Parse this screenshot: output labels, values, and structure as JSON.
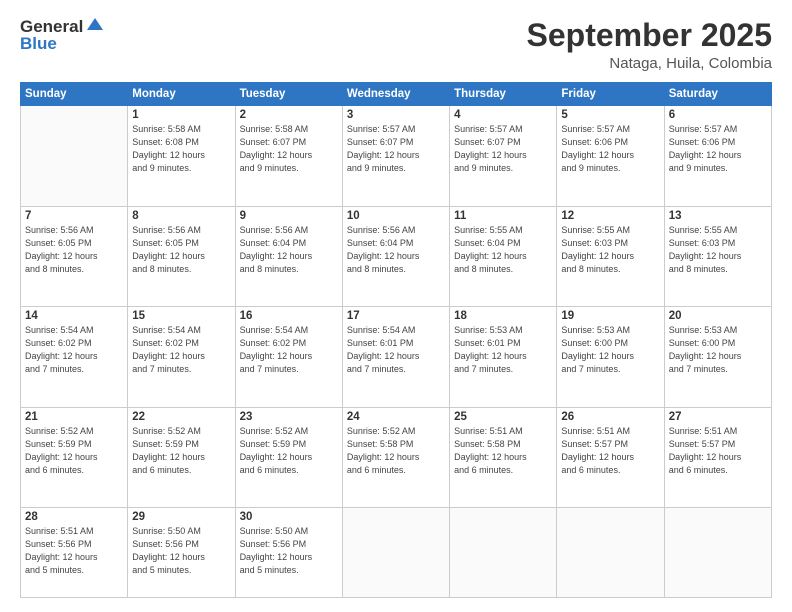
{
  "header": {
    "logo_general": "General",
    "logo_blue": "Blue",
    "month_title": "September 2025",
    "location": "Nataga, Huila, Colombia"
  },
  "weekdays": [
    "Sunday",
    "Monday",
    "Tuesday",
    "Wednesday",
    "Thursday",
    "Friday",
    "Saturday"
  ],
  "weeks": [
    [
      {
        "day": "",
        "info": ""
      },
      {
        "day": "1",
        "info": "Sunrise: 5:58 AM\nSunset: 6:08 PM\nDaylight: 12 hours\nand 9 minutes."
      },
      {
        "day": "2",
        "info": "Sunrise: 5:58 AM\nSunset: 6:07 PM\nDaylight: 12 hours\nand 9 minutes."
      },
      {
        "day": "3",
        "info": "Sunrise: 5:57 AM\nSunset: 6:07 PM\nDaylight: 12 hours\nand 9 minutes."
      },
      {
        "day": "4",
        "info": "Sunrise: 5:57 AM\nSunset: 6:07 PM\nDaylight: 12 hours\nand 9 minutes."
      },
      {
        "day": "5",
        "info": "Sunrise: 5:57 AM\nSunset: 6:06 PM\nDaylight: 12 hours\nand 9 minutes."
      },
      {
        "day": "6",
        "info": "Sunrise: 5:57 AM\nSunset: 6:06 PM\nDaylight: 12 hours\nand 9 minutes."
      }
    ],
    [
      {
        "day": "7",
        "info": "Sunrise: 5:56 AM\nSunset: 6:05 PM\nDaylight: 12 hours\nand 8 minutes."
      },
      {
        "day": "8",
        "info": "Sunrise: 5:56 AM\nSunset: 6:05 PM\nDaylight: 12 hours\nand 8 minutes."
      },
      {
        "day": "9",
        "info": "Sunrise: 5:56 AM\nSunset: 6:04 PM\nDaylight: 12 hours\nand 8 minutes."
      },
      {
        "day": "10",
        "info": "Sunrise: 5:56 AM\nSunset: 6:04 PM\nDaylight: 12 hours\nand 8 minutes."
      },
      {
        "day": "11",
        "info": "Sunrise: 5:55 AM\nSunset: 6:04 PM\nDaylight: 12 hours\nand 8 minutes."
      },
      {
        "day": "12",
        "info": "Sunrise: 5:55 AM\nSunset: 6:03 PM\nDaylight: 12 hours\nand 8 minutes."
      },
      {
        "day": "13",
        "info": "Sunrise: 5:55 AM\nSunset: 6:03 PM\nDaylight: 12 hours\nand 8 minutes."
      }
    ],
    [
      {
        "day": "14",
        "info": "Sunrise: 5:54 AM\nSunset: 6:02 PM\nDaylight: 12 hours\nand 7 minutes."
      },
      {
        "day": "15",
        "info": "Sunrise: 5:54 AM\nSunset: 6:02 PM\nDaylight: 12 hours\nand 7 minutes."
      },
      {
        "day": "16",
        "info": "Sunrise: 5:54 AM\nSunset: 6:02 PM\nDaylight: 12 hours\nand 7 minutes."
      },
      {
        "day": "17",
        "info": "Sunrise: 5:54 AM\nSunset: 6:01 PM\nDaylight: 12 hours\nand 7 minutes."
      },
      {
        "day": "18",
        "info": "Sunrise: 5:53 AM\nSunset: 6:01 PM\nDaylight: 12 hours\nand 7 minutes."
      },
      {
        "day": "19",
        "info": "Sunrise: 5:53 AM\nSunset: 6:00 PM\nDaylight: 12 hours\nand 7 minutes."
      },
      {
        "day": "20",
        "info": "Sunrise: 5:53 AM\nSunset: 6:00 PM\nDaylight: 12 hours\nand 7 minutes."
      }
    ],
    [
      {
        "day": "21",
        "info": "Sunrise: 5:52 AM\nSunset: 5:59 PM\nDaylight: 12 hours\nand 6 minutes."
      },
      {
        "day": "22",
        "info": "Sunrise: 5:52 AM\nSunset: 5:59 PM\nDaylight: 12 hours\nand 6 minutes."
      },
      {
        "day": "23",
        "info": "Sunrise: 5:52 AM\nSunset: 5:59 PM\nDaylight: 12 hours\nand 6 minutes."
      },
      {
        "day": "24",
        "info": "Sunrise: 5:52 AM\nSunset: 5:58 PM\nDaylight: 12 hours\nand 6 minutes."
      },
      {
        "day": "25",
        "info": "Sunrise: 5:51 AM\nSunset: 5:58 PM\nDaylight: 12 hours\nand 6 minutes."
      },
      {
        "day": "26",
        "info": "Sunrise: 5:51 AM\nSunset: 5:57 PM\nDaylight: 12 hours\nand 6 minutes."
      },
      {
        "day": "27",
        "info": "Sunrise: 5:51 AM\nSunset: 5:57 PM\nDaylight: 12 hours\nand 6 minutes."
      }
    ],
    [
      {
        "day": "28",
        "info": "Sunrise: 5:51 AM\nSunset: 5:56 PM\nDaylight: 12 hours\nand 5 minutes."
      },
      {
        "day": "29",
        "info": "Sunrise: 5:50 AM\nSunset: 5:56 PM\nDaylight: 12 hours\nand 5 minutes."
      },
      {
        "day": "30",
        "info": "Sunrise: 5:50 AM\nSunset: 5:56 PM\nDaylight: 12 hours\nand 5 minutes."
      },
      {
        "day": "",
        "info": ""
      },
      {
        "day": "",
        "info": ""
      },
      {
        "day": "",
        "info": ""
      },
      {
        "day": "",
        "info": ""
      }
    ]
  ]
}
